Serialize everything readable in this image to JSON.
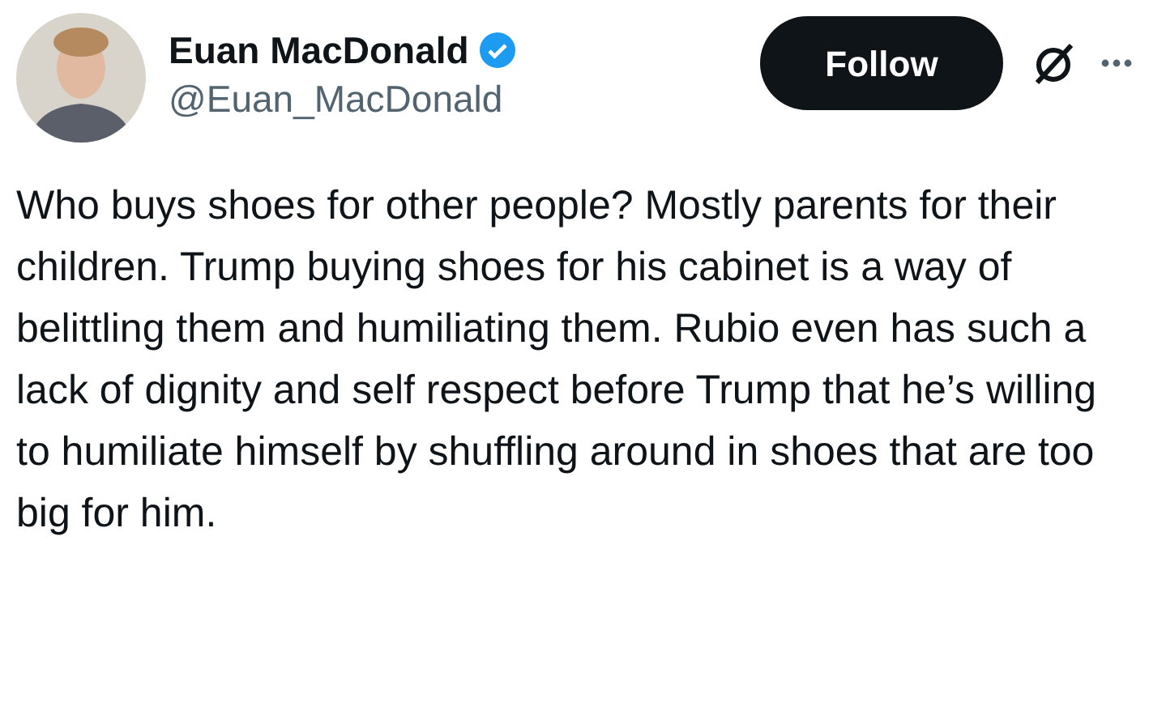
{
  "author": {
    "name": "Euan MacDonald",
    "verified": true,
    "handle": "@Euan_MacDonald"
  },
  "follow_button": {
    "label": "Follow"
  },
  "body": "Who buys shoes for other people? Mostly parents for their children. Trump buying shoes for his cabinet is a way of belittling them and humiliating them. Rubio even has such a lack of dignity and self respect before Trump that he’s willing to humiliate himself by shuffling around in shoes that are too big for him."
}
